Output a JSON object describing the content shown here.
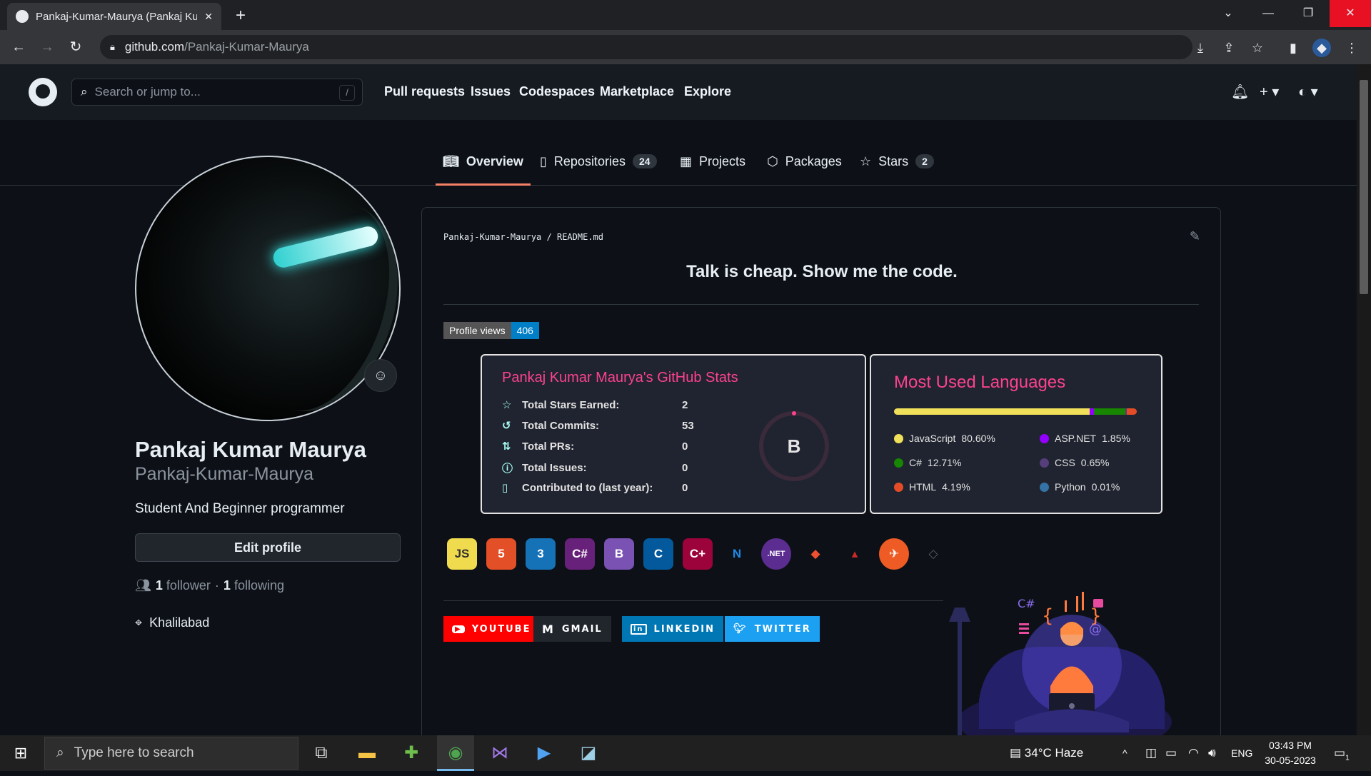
{
  "browser": {
    "tab_title": "Pankaj-Kumar-Maurya (Pankaj Ku",
    "url_host": "github.com",
    "url_path": "/Pankaj-Kumar-Maurya"
  },
  "github": {
    "search_placeholder": "Search or jump to...",
    "search_shortcut": "/",
    "nav": [
      "Pull requests",
      "Issues",
      "Codespaces",
      "Marketplace",
      "Explore"
    ]
  },
  "profile_tabs": [
    {
      "label": "Overview",
      "icon": "book-icon"
    },
    {
      "label": "Repositories",
      "icon": "repo-icon",
      "count": "24"
    },
    {
      "label": "Projects",
      "icon": "table-icon"
    },
    {
      "label": "Packages",
      "icon": "package-icon"
    },
    {
      "label": "Stars",
      "icon": "star-icon",
      "count": "2"
    }
  ],
  "profile": {
    "name": "Pankaj Kumar Maurya",
    "login": "Pankaj-Kumar-Maurya",
    "bio": "Student And Beginner programmer",
    "edit_label": "Edit profile",
    "followers": "1",
    "followers_label": "follower",
    "separator": "·",
    "following": "1",
    "following_label": "following",
    "location": "Khalilabad"
  },
  "readme": {
    "path_user": "Pankaj-Kumar-Maurya",
    "path_sep": "/",
    "path_file": "README.md",
    "heading": "Talk is cheap. Show me the code.",
    "views_label": "Profile views",
    "views_count": "406"
  },
  "stats": {
    "title": "Pankaj Kumar Maurya's GitHub Stats",
    "rows": [
      {
        "label": "Total Stars Earned:",
        "value": "2",
        "icon": "star-icon"
      },
      {
        "label": "Total Commits:",
        "value": "53",
        "icon": "history-icon"
      },
      {
        "label": "Total PRs:",
        "value": "0",
        "icon": "pull-request-icon"
      },
      {
        "label": "Total Issues:",
        "value": "0",
        "icon": "issue-icon"
      },
      {
        "label": "Contributed to (last year):",
        "value": "0",
        "icon": "repo-icon"
      }
    ],
    "rank": "B",
    "accent": "#fe428e"
  },
  "languages": {
    "title": "Most Used Languages",
    "items": [
      {
        "name": "JavaScript",
        "percent": "80.60%",
        "share": 80.6,
        "color": "#f1e05a"
      },
      {
        "name": "ASP.NET",
        "percent": "1.85%",
        "share": 1.85,
        "color": "#9400ff"
      },
      {
        "name": "C#",
        "percent": "12.71%",
        "share": 12.71,
        "color": "#178600"
      },
      {
        "name": "CSS",
        "percent": "0.65%",
        "share": 0.65,
        "color": "#563d7c"
      },
      {
        "name": "HTML",
        "percent": "4.19%",
        "share": 4.19,
        "color": "#e34c26"
      },
      {
        "name": "Python",
        "percent": "0.01%",
        "share": 0.01,
        "color": "#3572a5"
      }
    ]
  },
  "tech_icons": [
    {
      "name": "javascript-icon",
      "text": "JS",
      "bg": "#f0db4f",
      "fg": "#323330"
    },
    {
      "name": "html5-icon",
      "text": "5",
      "bg": "#e34f26",
      "fg": "#ffffff"
    },
    {
      "name": "css3-icon",
      "text": "3",
      "bg": "#1572b6",
      "fg": "#ffffff"
    },
    {
      "name": "csharp-icon",
      "text": "C#",
      "bg": "#68217a",
      "fg": "#ffffff"
    },
    {
      "name": "bootstrap-icon",
      "text": "B",
      "bg": "#7952b3",
      "fg": "#ffffff"
    },
    {
      "name": "c-icon",
      "text": "C",
      "bg": "#03599c",
      "fg": "#ffffff"
    },
    {
      "name": "cplusplus-icon",
      "text": "C+",
      "bg": "#9c033a",
      "fg": "#ffffff"
    },
    {
      "name": "dotnet-icon",
      "text": "N",
      "bg": "#0d1117",
      "fg": "#1e88e5"
    },
    {
      "name": "dotnet-core-icon",
      "text": ".NET",
      "bg": "#5c2d91",
      "fg": "#ffffff"
    },
    {
      "name": "git-icon",
      "text": "◆",
      "bg": "#0d1117",
      "fg": "#f05032"
    },
    {
      "name": "sql-server-icon",
      "text": "▴",
      "bg": "#0d1117",
      "fg": "#cc2927"
    },
    {
      "name": "postman-icon",
      "text": "✈",
      "bg": "#ef5b25",
      "fg": "#ffffff"
    },
    {
      "name": "unity-icon",
      "text": "◇",
      "bg": "#0d1117",
      "fg": "#555c66"
    }
  ],
  "social": [
    {
      "name": "youtube-button",
      "label": "YOUTUBE",
      "icon": "youtube-icon",
      "bg": "#ff0000"
    },
    {
      "name": "gmail-button",
      "label": "GMAIL",
      "icon": "gmail-icon",
      "bg": "#21262d"
    },
    {
      "name": "linkedin-button",
      "label": "LINKEDIN",
      "icon": "linkedin-icon",
      "bg": "#0077b5"
    },
    {
      "name": "twitter-button",
      "label": "TWITTER",
      "icon": "twitter-icon",
      "bg": "#1ca0f2"
    }
  ],
  "taskbar": {
    "search_placeholder": "Type here to search",
    "weather": "34°C  Haze",
    "lang": "ENG",
    "time": "03:43 PM",
    "date": "30-05-2023",
    "notifications": "1"
  }
}
